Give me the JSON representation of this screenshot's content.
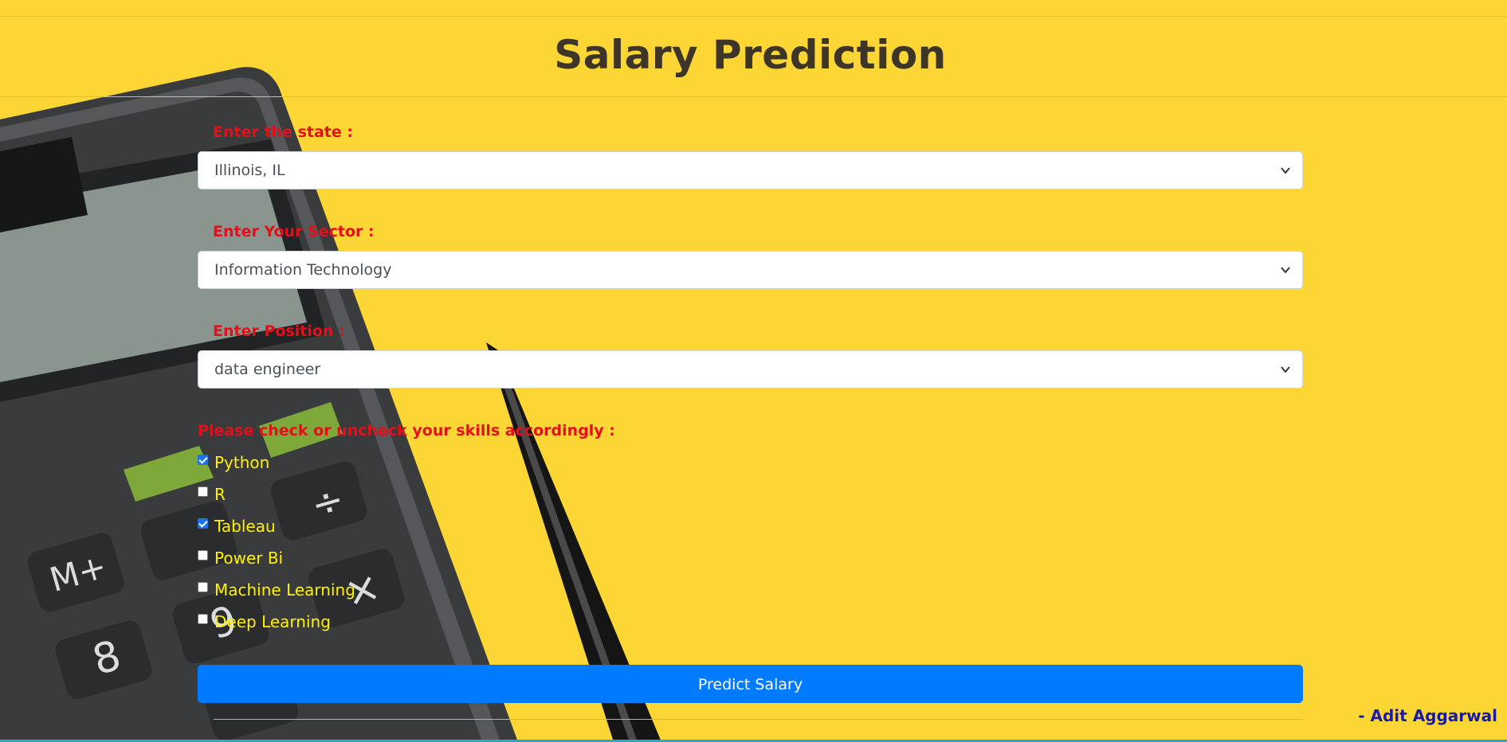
{
  "page": {
    "title": "Salary Prediction"
  },
  "form": {
    "state": {
      "label": "Enter the state :",
      "value": "Illinois, IL"
    },
    "sector": {
      "label": "Enter Your Sector :",
      "value": "Information Technology"
    },
    "position": {
      "label": "Enter Position :",
      "value": "data engineer"
    },
    "skills": {
      "label": "Please check or uncheck your skills accordingly :",
      "items": [
        {
          "label": "Python",
          "checked": true
        },
        {
          "label": "R",
          "checked": false
        },
        {
          "label": "Tableau",
          "checked": true
        },
        {
          "label": "Power Bi",
          "checked": false
        },
        {
          "label": "Machine Learning",
          "checked": false
        },
        {
          "label": "Deep Learning",
          "checked": false
        }
      ]
    },
    "submit_label": "Predict Salary"
  },
  "footer": {
    "author": "- Adit Aggarwal"
  },
  "colors": {
    "background": "#fcd635",
    "label_red": "#e3101a",
    "skill_yellow": "#fff200",
    "button_blue": "#007bff",
    "author_blue": "#1a1aa6"
  }
}
